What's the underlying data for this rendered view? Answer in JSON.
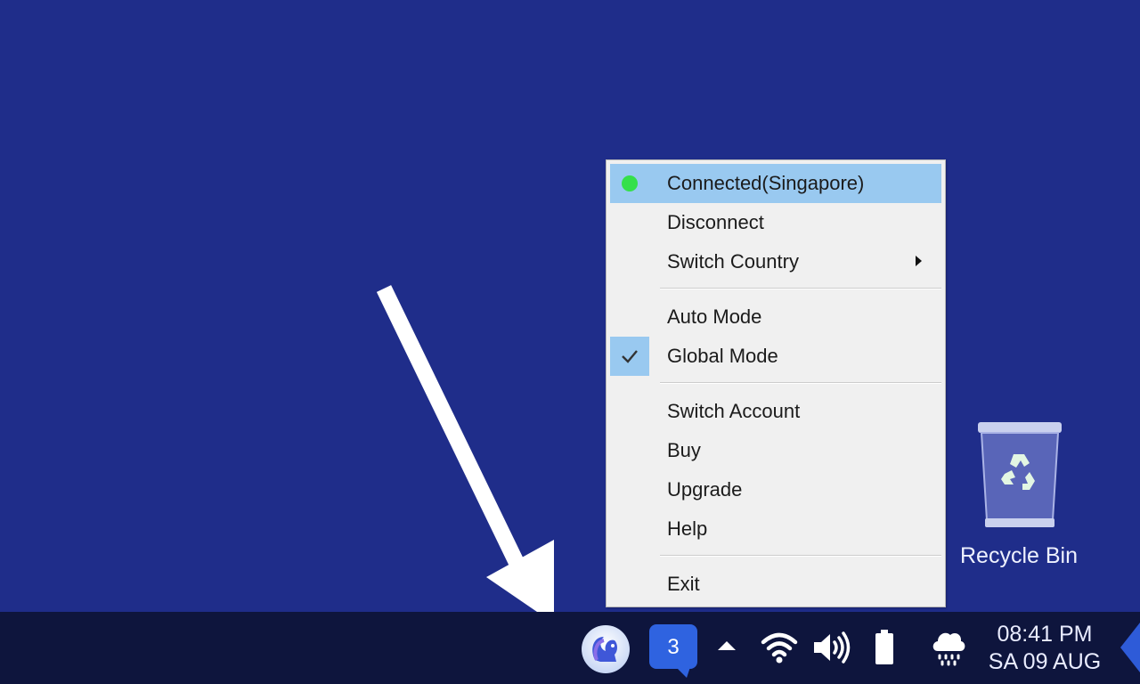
{
  "menu": {
    "items": [
      {
        "label": "Connected(Singapore)"
      },
      {
        "label": "Disconnect"
      },
      {
        "label": "Switch Country"
      },
      {
        "label": "Auto Mode"
      },
      {
        "label": "Global Mode"
      },
      {
        "label": "Switch Account"
      },
      {
        "label": "Buy"
      },
      {
        "label": "Upgrade"
      },
      {
        "label": "Help"
      },
      {
        "label": "Exit"
      }
    ],
    "highlighted_item": "Connected(Singapore)",
    "checked_item": "Global Mode",
    "status_color": "#35e04a",
    "highlight_color": "#99c9f0"
  },
  "desktop": {
    "background_color": "#1f2d8a",
    "recycle_bin_label": "Recycle Bin"
  },
  "taskbar": {
    "notification_count": "3",
    "time": "08:41 PM",
    "date": "SA 09 AUG",
    "icons": [
      "squirrel-app-icon",
      "notification-icon",
      "chevron-up-icon",
      "wifi-icon",
      "volume-icon",
      "battery-icon",
      "weather-rain-icon"
    ]
  }
}
